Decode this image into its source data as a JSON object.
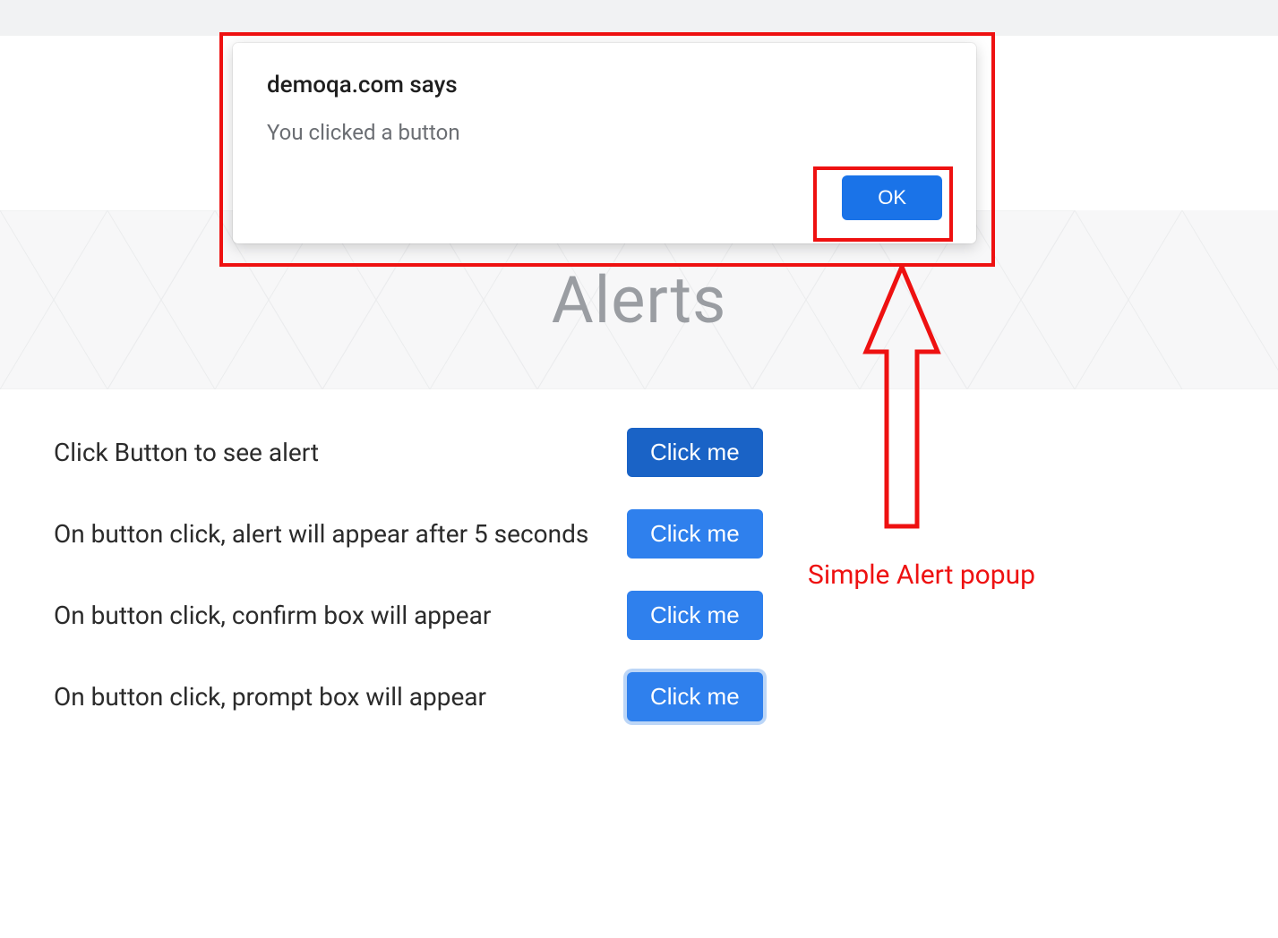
{
  "dialog": {
    "title": "demoqa.com says",
    "message": "You clicked a button",
    "ok_label": "OK"
  },
  "page": {
    "title": "Alerts"
  },
  "rows": [
    {
      "label": "Click Button to see alert",
      "button": "Click me"
    },
    {
      "label": "On button click, alert will appear after 5 seconds",
      "button": "Click me"
    },
    {
      "label": "On button click, confirm box will appear",
      "button": "Click me"
    },
    {
      "label": "On button click, prompt box will appear",
      "button": "Click me"
    }
  ],
  "annotation": {
    "label": "Simple Alert popup"
  }
}
